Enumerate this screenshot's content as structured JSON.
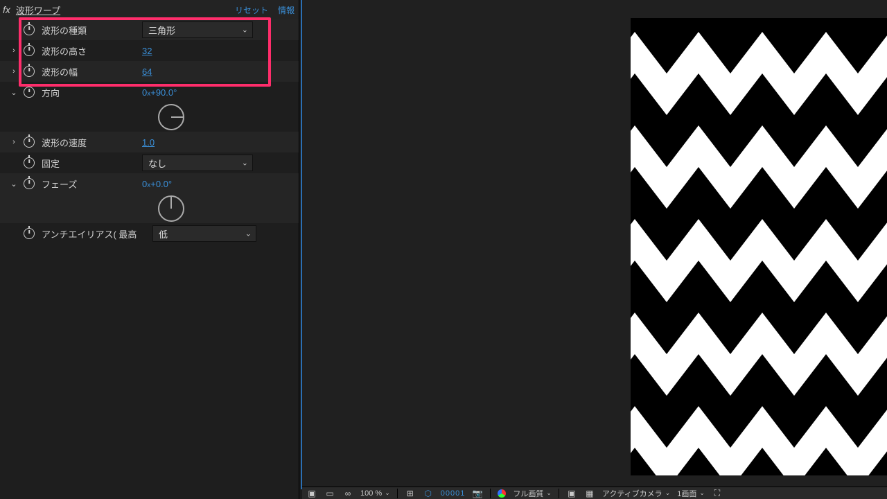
{
  "effect": {
    "fx_label": "fx",
    "title": "波形ワープ",
    "reset": "リセット",
    "about": "情報"
  },
  "props": {
    "wave_type": {
      "label": "波形の種類",
      "value": "三角形"
    },
    "wave_height": {
      "label": "波形の高さ",
      "value": "32"
    },
    "wave_width": {
      "label": "波形の幅",
      "value": "64"
    },
    "direction": {
      "label": "方向",
      "value_turns": "0",
      "value_x": "x",
      "value_deg": "+90.0",
      "suffix": "°"
    },
    "wave_speed": {
      "label": "波形の速度",
      "value": "1.0"
    },
    "pinning": {
      "label": "固定",
      "value": "なし"
    },
    "phase": {
      "label": "フェーズ",
      "value_turns": "0",
      "value_x": "x",
      "value_deg": "+0.0",
      "suffix": "°"
    },
    "antialias": {
      "label": "アンチエイリアス( 最高",
      "value": "低"
    }
  },
  "viewer_bar": {
    "zoom": "100 %",
    "timecode": "00001",
    "quality": "フル画質",
    "camera": "アクティブカメラ",
    "views": "1画面"
  },
  "colors": {
    "highlight_border": "#ff2d6b",
    "accent_blue": "#3a8fd8"
  }
}
